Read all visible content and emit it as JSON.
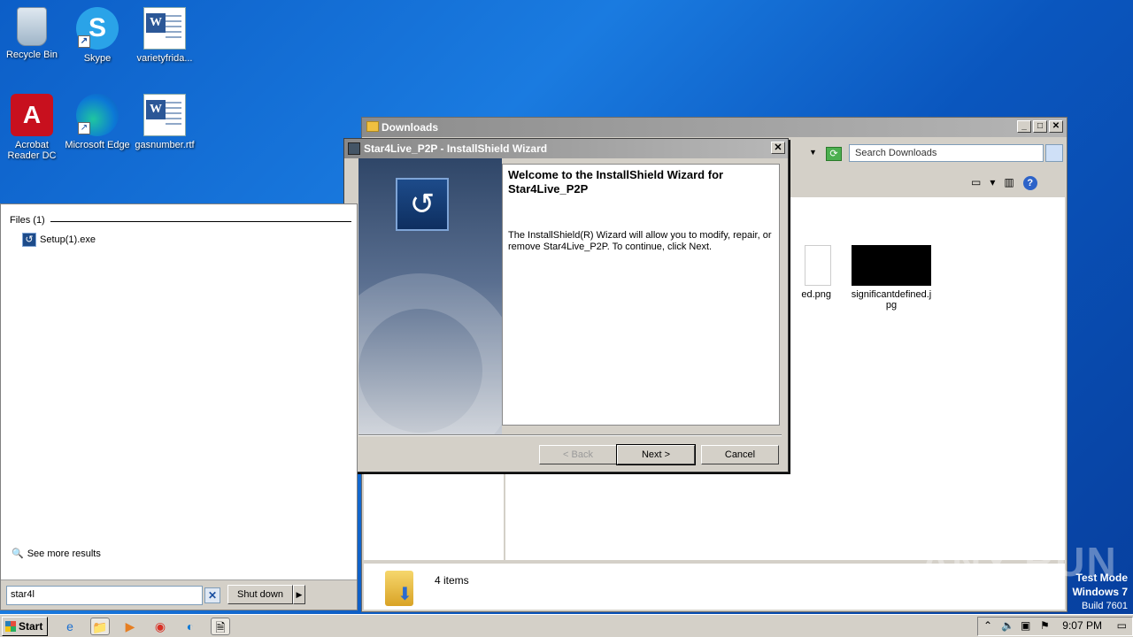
{
  "desktop": {
    "icons": [
      {
        "label": "Recycle Bin"
      },
      {
        "label": "Skype"
      },
      {
        "label": "varietyfrida..."
      },
      {
        "label": "Acrobat Reader DC"
      },
      {
        "label": "Microsoft Edge"
      },
      {
        "label": "gasnumber.rtf"
      }
    ]
  },
  "explorer": {
    "title": "Downloads",
    "search_placeholder": "Search Downloads",
    "files": [
      {
        "name": "ed.png"
      },
      {
        "name": "significantdefined.jpg"
      }
    ],
    "items_count": "4 items"
  },
  "wizard": {
    "title": "Star4Live_P2P - InstallShield Wizard",
    "heading": "Welcome to the InstallShield Wizard for Star4Live_P2P",
    "body": "The InstallShield(R) Wizard will allow you to modify, repair, or remove Star4Live_P2P. To continue, click Next.",
    "back_label": "< Back",
    "next_label": "Next >",
    "cancel_label": "Cancel"
  },
  "startmenu": {
    "files_header": "Files (1)",
    "result": "Setup(1).exe",
    "see_more": "See more results",
    "search_value": "star4l",
    "shutdown_label": "Shut down"
  },
  "taskbar": {
    "start_label": "Start",
    "clock": "9:07 PM"
  },
  "watermark": {
    "line1": "Test Mode",
    "line2": "Windows 7",
    "line3": "Build 7601"
  },
  "anyrun": "ANY RUN"
}
